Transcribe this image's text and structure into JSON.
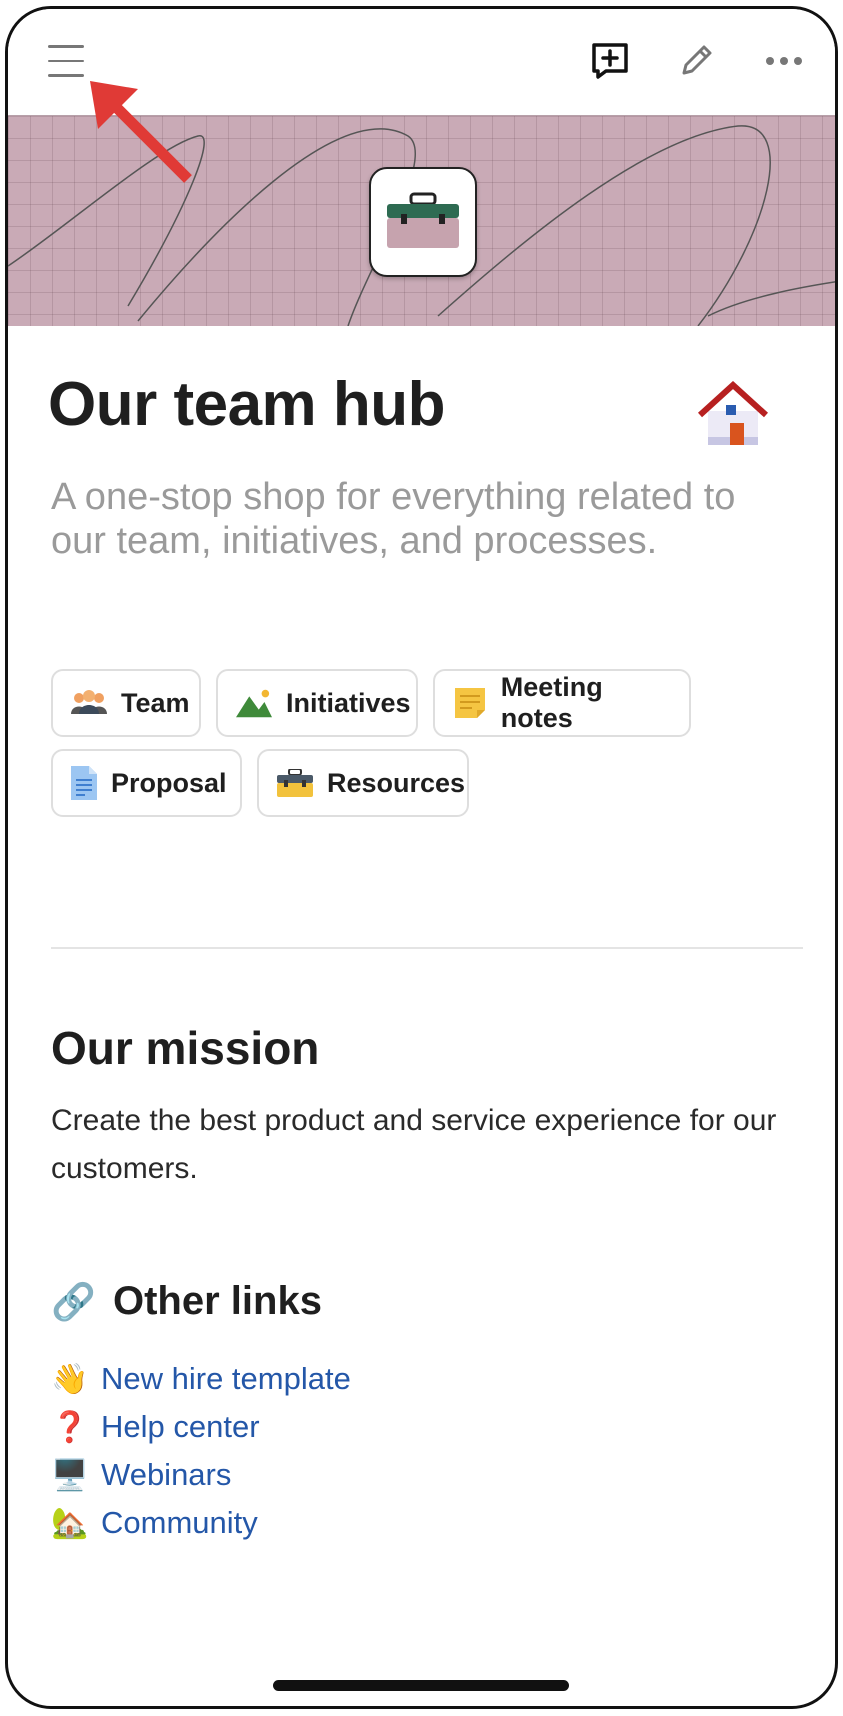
{
  "topbar": {
    "menu_icon": "hamburger-menu-icon",
    "actions": [
      "add-page-icon",
      "edit-pencil-icon",
      "more-options-icon"
    ]
  },
  "cover": {
    "icon": "toolbox-icon"
  },
  "page": {
    "title": "Our team hub",
    "title_icon": "house-icon",
    "subtitle": "A one-stop shop for everything related to our team, initiatives, and processes."
  },
  "chips": [
    {
      "label": "Team",
      "icon": "people-icon"
    },
    {
      "label": "Initiatives",
      "icon": "mountain-icon"
    },
    {
      "label": "Meeting notes",
      "icon": "note-icon"
    },
    {
      "label": "Proposal",
      "icon": "document-icon"
    },
    {
      "label": "Resources",
      "icon": "toolbox-icon"
    }
  ],
  "mission": {
    "heading": "Our mission",
    "text": "Create the best product and service experience for our customers."
  },
  "other_links": {
    "emoji": "🔗",
    "heading": "Other links",
    "items": [
      {
        "emoji": "👋",
        "label": "New hire template"
      },
      {
        "emoji": "❓",
        "label": "Help center"
      },
      {
        "emoji": "🖥️",
        "label": "Webinars"
      },
      {
        "emoji": "🏡",
        "label": "Community"
      }
    ]
  },
  "colors": {
    "accent_link": "#2457a8",
    "cover": "#c9aab6",
    "arrow": "#e03a36"
  }
}
